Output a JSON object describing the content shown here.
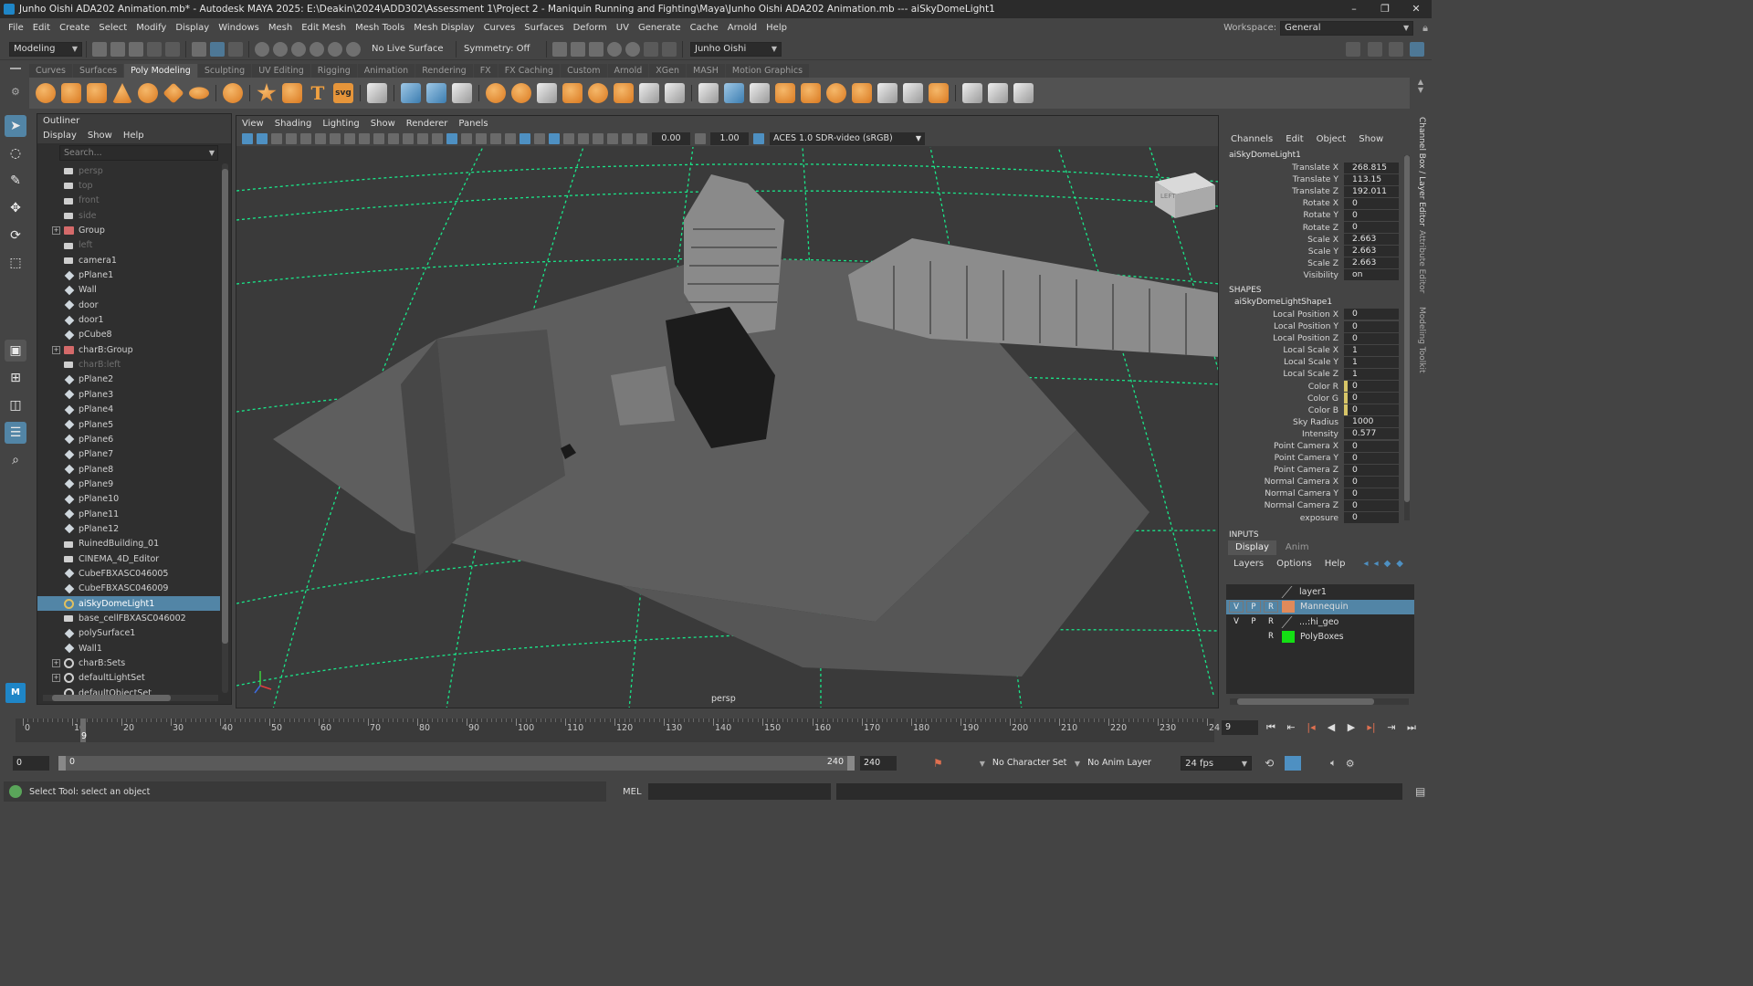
{
  "titlebar": {
    "title": "Junho Oishi ADA202 Animation.mb* - Autodesk MAYA 2025: E:\\Deakin\\2024\\ADD302\\Assessment 1\\Project 2 - Maniquin Running and Fighting\\Maya\\Junho Oishi ADA202 Animation.mb    ---    aiSkyDomeLight1",
    "minimize": "–",
    "maximize": "❐",
    "close": "✕"
  },
  "menubar": {
    "items": [
      "File",
      "Edit",
      "Create",
      "Select",
      "Modify",
      "Display",
      "Windows",
      "Mesh",
      "Edit Mesh",
      "Mesh Tools",
      "Mesh Display",
      "Curves",
      "Surfaces",
      "Deform",
      "UV",
      "Generate",
      "Cache",
      "Arnold",
      "Help"
    ],
    "workspace_label": "Workspace:",
    "workspace_value": "General"
  },
  "statusline": {
    "mode": "Modeling",
    "live_surface": "No Live Surface",
    "symmetry": "Symmetry: Off",
    "user": "Junho Oishi"
  },
  "shelf": {
    "tabs": [
      "Curves",
      "Surfaces",
      "Poly Modeling",
      "Sculpting",
      "UV Editing",
      "Rigging",
      "Animation",
      "Rendering",
      "FX",
      "FX Caching",
      "Custom",
      "Arnold",
      "XGen",
      "MASH",
      "Motion Graphics"
    ],
    "active_tab": "Poly Modeling",
    "text_icon": "T",
    "svg_icon": "svg"
  },
  "outliner": {
    "title": "Outliner",
    "menu": [
      "Display",
      "Show",
      "Help"
    ],
    "search_placeholder": "Search...",
    "items": [
      {
        "label": "persp",
        "icon": "camera-icon",
        "dim": true
      },
      {
        "label": "top",
        "icon": "camera-icon",
        "dim": true
      },
      {
        "label": "front",
        "icon": "camera-icon",
        "dim": true
      },
      {
        "label": "side",
        "icon": "camera-icon",
        "dim": true
      },
      {
        "label": "Group",
        "icon": "group-icon",
        "expand": true
      },
      {
        "label": "left",
        "icon": "camera-icon",
        "dim": true
      },
      {
        "label": "camera1",
        "icon": "camera-icon"
      },
      {
        "label": "pPlane1",
        "icon": "mesh-icon"
      },
      {
        "label": "Wall",
        "icon": "mesh-icon"
      },
      {
        "label": "door",
        "icon": "mesh-icon"
      },
      {
        "label": "door1",
        "icon": "mesh-icon"
      },
      {
        "label": "pCube8",
        "icon": "mesh-icon"
      },
      {
        "label": "charB:Group",
        "icon": "group-icon",
        "expand": true
      },
      {
        "label": "charB:left",
        "icon": "camera-icon",
        "dim": true
      },
      {
        "label": "pPlane2",
        "icon": "mesh-icon"
      },
      {
        "label": "pPlane3",
        "icon": "mesh-icon"
      },
      {
        "label": "pPlane4",
        "icon": "mesh-icon"
      },
      {
        "label": "pPlane5",
        "icon": "mesh-icon"
      },
      {
        "label": "pPlane6",
        "icon": "mesh-icon"
      },
      {
        "label": "pPlane7",
        "icon": "mesh-icon"
      },
      {
        "label": "pPlane8",
        "icon": "mesh-icon"
      },
      {
        "label": "pPlane9",
        "icon": "mesh-icon"
      },
      {
        "label": "pPlane10",
        "icon": "mesh-icon"
      },
      {
        "label": "pPlane11",
        "icon": "mesh-icon"
      },
      {
        "label": "pPlane12",
        "icon": "mesh-icon"
      },
      {
        "label": "RuinedBuilding_01",
        "icon": "camera-icon"
      },
      {
        "label": "CINEMA_4D_Editor",
        "icon": "camera-icon"
      },
      {
        "label": "CubeFBXASC046005",
        "icon": "mesh-icon"
      },
      {
        "label": "CubeFBXASC046009",
        "icon": "mesh-icon"
      },
      {
        "label": "aiSkyDomeLight1",
        "icon": "light-icon",
        "selected": true
      },
      {
        "label": "base_cellFBXASC046002",
        "icon": "camera-icon"
      },
      {
        "label": "polySurface1",
        "icon": "mesh-icon"
      },
      {
        "label": "Wall1",
        "icon": "mesh-icon"
      },
      {
        "label": "charB:Sets",
        "icon": "set-icon",
        "expand": true
      },
      {
        "label": "defaultLightSet",
        "icon": "set-icon",
        "expand": true
      },
      {
        "label": "defaultObjectSet",
        "icon": "set-icon"
      }
    ]
  },
  "viewport": {
    "menu": [
      "View",
      "Shading",
      "Lighting",
      "Show",
      "Renderer",
      "Panels"
    ],
    "near_value": "0.00",
    "far_value": "1.00",
    "color_space": "ACES 1.0 SDR-video (sRGB)",
    "camera_label": "persp",
    "viewcube_label": "LEFT"
  },
  "channelbox": {
    "menu": [
      "Channels",
      "Edit",
      "Object",
      "Show"
    ],
    "object": "aiSkyDomeLight1",
    "channels": [
      {
        "name": "Translate X",
        "value": "268.815"
      },
      {
        "name": "Translate Y",
        "value": "113.15"
      },
      {
        "name": "Translate Z",
        "value": "192.011"
      },
      {
        "name": "Rotate X",
        "value": "0"
      },
      {
        "name": "Rotate Y",
        "value": "0"
      },
      {
        "name": "Rotate Z",
        "value": "0"
      },
      {
        "name": "Scale X",
        "value": "2.663"
      },
      {
        "name": "Scale Y",
        "value": "2.663"
      },
      {
        "name": "Scale Z",
        "value": "2.663"
      },
      {
        "name": "Visibility",
        "value": "on"
      }
    ],
    "shapes_header": "SHAPES",
    "shape_name": "aiSkyDomeLightShape1",
    "shape_channels": [
      {
        "name": "Local Position X",
        "value": "0"
      },
      {
        "name": "Local Position Y",
        "value": "0"
      },
      {
        "name": "Local Position Z",
        "value": "0"
      },
      {
        "name": "Local Scale X",
        "value": "1"
      },
      {
        "name": "Local Scale Y",
        "value": "1"
      },
      {
        "name": "Local Scale Z",
        "value": "1"
      },
      {
        "name": "Color R",
        "value": "0",
        "color": true
      },
      {
        "name": "Color G",
        "value": "0",
        "color": true
      },
      {
        "name": "Color B",
        "value": "0",
        "color": true
      },
      {
        "name": "Sky Radius",
        "value": "1000"
      },
      {
        "name": "Intensity",
        "value": "0.577"
      },
      {
        "name": "Point Camera X",
        "value": "0"
      },
      {
        "name": "Point Camera Y",
        "value": "0"
      },
      {
        "name": "Point Camera Z",
        "value": "0"
      },
      {
        "name": "Normal Camera X",
        "value": "0"
      },
      {
        "name": "Normal Camera Y",
        "value": "0"
      },
      {
        "name": "Normal Camera Z",
        "value": "0"
      },
      {
        "name": "exposure",
        "value": "0"
      }
    ],
    "inputs_header": "INPUTS",
    "side_tabs": [
      "Channel Box / Layer Editor",
      "Attribute Editor",
      "Modeling Toolkit"
    ]
  },
  "layer_editor": {
    "tabs": [
      "Display",
      "Anim"
    ],
    "menu": [
      "Layers",
      "Options",
      "Help"
    ],
    "layers": [
      {
        "name": "layer1",
        "v": "",
        "p": "",
        "r": "",
        "color": ""
      },
      {
        "name": "Mannequin",
        "v": "V",
        "p": "P",
        "r": "R",
        "color": "#e08a5a",
        "selected": true
      },
      {
        "name": "...:hi_geo",
        "v": "V",
        "p": "P",
        "r": "R",
        "color": ""
      },
      {
        "name": "PolyBoxes",
        "v": "",
        "p": "",
        "r": "R",
        "color": "#14e014"
      }
    ]
  },
  "timeline": {
    "ticks": [
      "0",
      "10",
      "20",
      "30",
      "40",
      "50",
      "60",
      "70",
      "80",
      "90",
      "100",
      "110",
      "120",
      "130",
      "140",
      "150",
      "160",
      "170",
      "180",
      "190",
      "200",
      "210",
      "220",
      "230",
      "24"
    ],
    "current_frame": "9",
    "frame_field": "9"
  },
  "range": {
    "start": "0",
    "inner_start": "0",
    "inner_end": "240",
    "end": "240",
    "character_set": "No Character Set",
    "anim_layer": "No Anim Layer",
    "fps": "24 fps"
  },
  "helpline": {
    "text": "Select Tool: select an object",
    "mel": "MEL"
  },
  "colors": {
    "selection": "#5285a6",
    "grid": "#19e88a",
    "panel": "#444444"
  }
}
